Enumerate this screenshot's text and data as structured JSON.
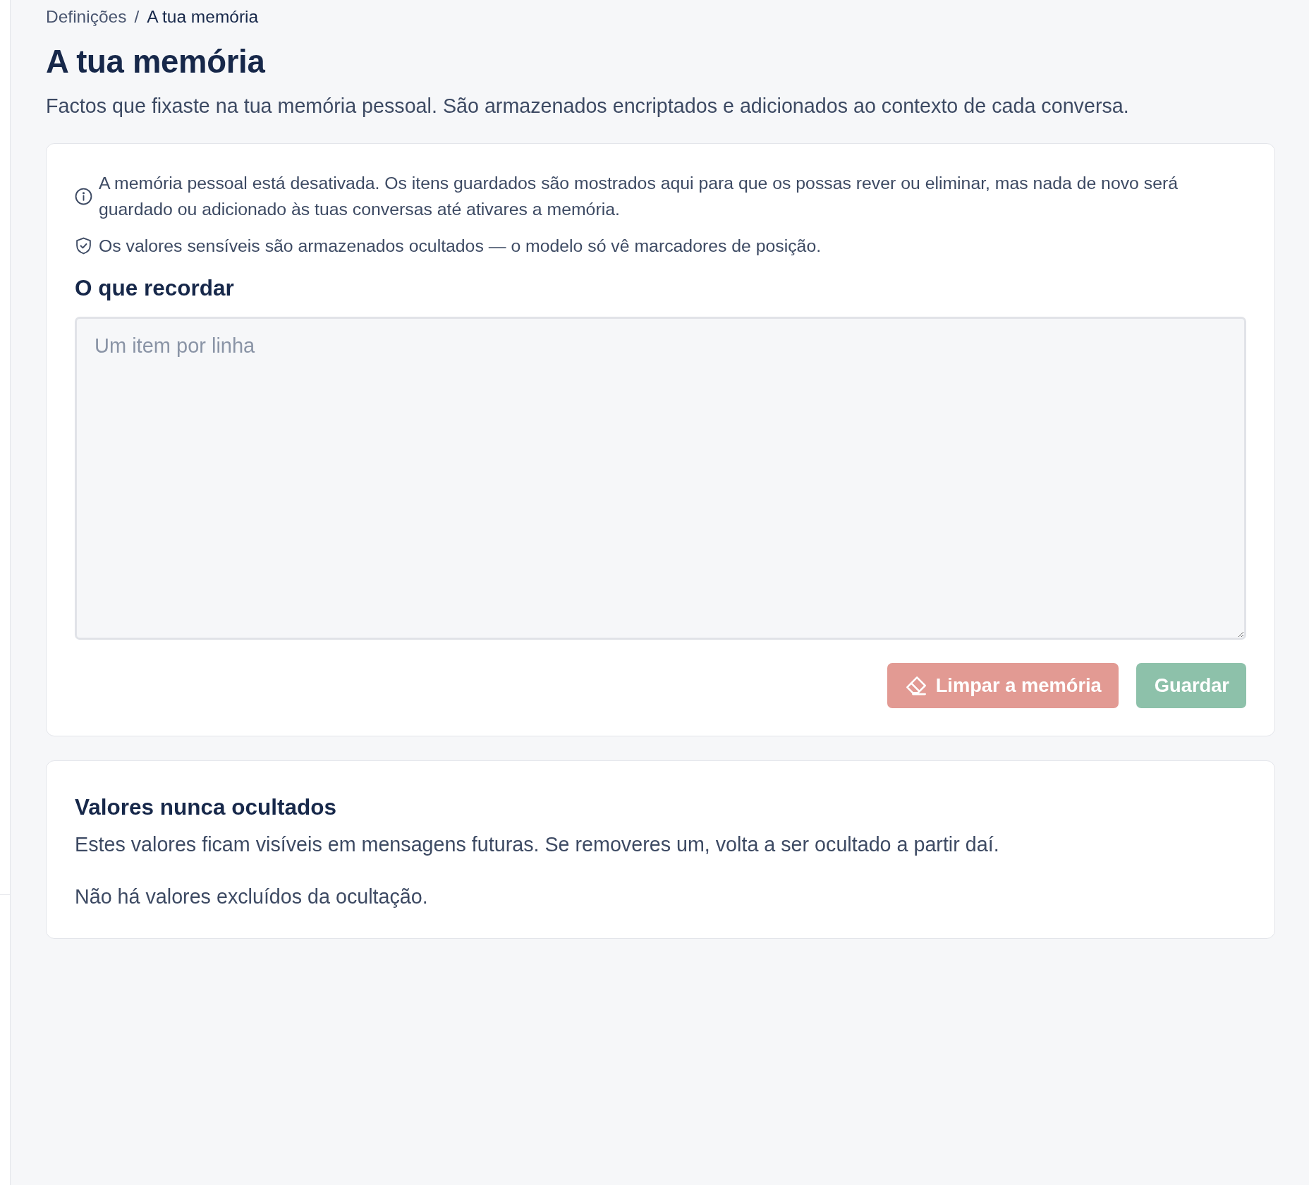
{
  "breadcrumb": {
    "separator": "/",
    "items": [
      {
        "label": "Definições",
        "current": false
      },
      {
        "label": "A tua memória",
        "current": true
      }
    ]
  },
  "page": {
    "title": "A tua memória",
    "subtitle": "Factos que fixaste na tua memória pessoal. São armazenados encriptados e adicionados ao contexto de cada conversa."
  },
  "memory_card": {
    "notices": [
      {
        "kind": "info",
        "text": "A memória pessoal está desativada. Os itens guardados são mostrados aqui para que os possas rever ou eliminar, mas nada de novo será guardado ou adicionado às tuas conversas até ativares a memória."
      },
      {
        "kind": "shield",
        "text": "Os valores sensíveis são armazenados ocultados — o modelo só vê marcadores de posição."
      }
    ],
    "section_title": "O que recordar",
    "textarea": {
      "placeholder": "Um item por linha"
    },
    "buttons": [
      {
        "kind": "danger",
        "label": "Limpar a memória",
        "disabled": true
      },
      {
        "kind": "primary",
        "label": "Guardar",
        "disabled": true
      }
    ]
  },
  "exclusions_card": {
    "title": "Valores nunca ocultados",
    "description": "Estes valores ficam visíveis em mensagens futuras. Se removeres um, volta a ser ocultado a partir daí.",
    "empty_text": "Não há valores excluídos da ocultação."
  }
}
